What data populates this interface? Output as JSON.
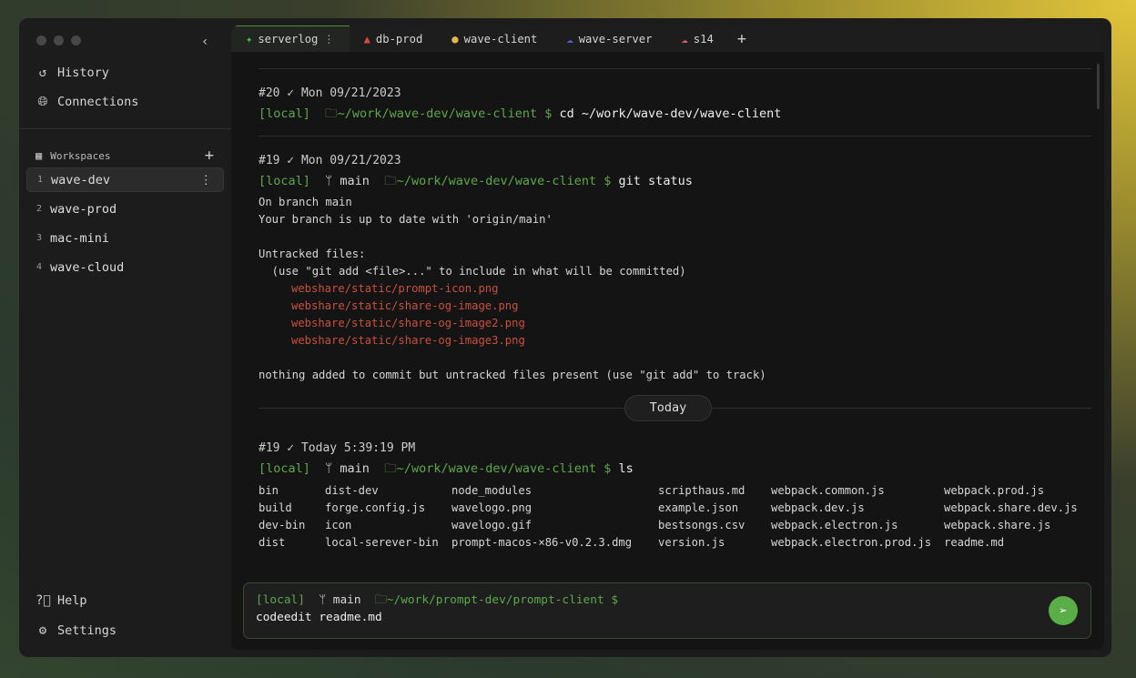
{
  "sidebar": {
    "nav": [
      {
        "label": "History",
        "icon": "history-icon"
      },
      {
        "label": "Connections",
        "icon": "globe-icon"
      }
    ],
    "workspaces_label": "Workspaces",
    "workspaces": [
      {
        "num": "1",
        "name": "wave-dev",
        "active": true
      },
      {
        "num": "2",
        "name": "wave-prod"
      },
      {
        "num": "3",
        "name": "mac-mini"
      },
      {
        "num": "4",
        "name": "wave-cloud"
      }
    ],
    "bottom": [
      {
        "label": "Help",
        "icon": "help-icon"
      },
      {
        "label": "Settings",
        "icon": "gear-icon"
      }
    ]
  },
  "tabs": [
    {
      "label": "serverlog",
      "icon": "sparkle-icon",
      "color": "#4fbf3a",
      "active": true
    },
    {
      "label": "db-prod",
      "icon": "flame-icon",
      "color": "#e0453a"
    },
    {
      "label": "wave-client",
      "icon": "ghost-icon",
      "color": "#e3b74a"
    },
    {
      "label": "wave-server",
      "icon": "cloud-icon",
      "color": "#5a5ad6"
    },
    {
      "label": "s14",
      "icon": "cloud-icon",
      "color": "#d65a6a"
    }
  ],
  "blocks": [
    {
      "hdr": "#20 ✓ Mon 09/21/2023",
      "host": "[local]",
      "branch": "",
      "path": "~/work/wave-dev/wave-client $",
      "cmd": "cd ~/work/wave-dev/wave-client"
    },
    {
      "hdr": "#19 ✓ Mon 09/21/2023",
      "host": "[local]",
      "branch": "main",
      "path": "~/work/wave-dev/wave-client $",
      "cmd": "git status",
      "out1": "On branch main\nYour branch is up to date with 'origin/main'\n\nUntracked files:\n  (use \"git add <file>...\" to include in what will be committed)",
      "untracked": [
        "webshare/static/prompt-icon.png",
        "webshare/static/share-og-image.png",
        "webshare/static/share-og-image2.png",
        "webshare/static/share-og-image3.png"
      ],
      "out2": "nothing added to commit but untracked files present (use \"git add\" to track)"
    },
    {
      "hdr": "#19 ✓ Today 5:39:19 PM",
      "host": "[local]",
      "branch": "main",
      "path": "~/work/wave-dev/wave-client $",
      "cmd": "ls",
      "files": [
        "bin",
        "dist-dev",
        "node_modules",
        "scripthaus.md",
        "webpack.common.js",
        "webpack.prod.js",
        "build",
        "forge.config.js",
        "wavelogo.png",
        "example.json",
        "webpack.dev.js",
        "webpack.share.dev.js",
        "dev-bin",
        "icon",
        "wavelogo.gif",
        "bestsongs.csv",
        "webpack.electron.js",
        "webpack.share.js",
        "dist",
        "local-serever-bin",
        "prompt-macos-×86-v0.2.3.dmg",
        "version.js",
        "webpack.electron.prod.js",
        "readme.md"
      ]
    }
  ],
  "divider": "Today",
  "input": {
    "host": "[local]",
    "branch": "main",
    "path": "~/work/prompt-dev/prompt-client $",
    "value": "codeedit readme.md"
  },
  "colors": {
    "accent": "#5aae47",
    "error": "#c9503e"
  }
}
